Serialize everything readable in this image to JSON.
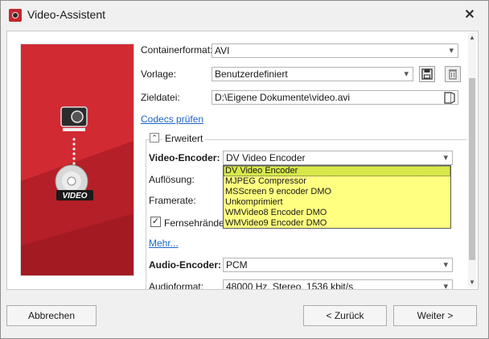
{
  "window": {
    "title": "Video-Assistent",
    "close_symbol": "✕"
  },
  "form": {
    "containerformat_label": "Containerformat:",
    "containerformat_value": "AVI",
    "vorlage_label": "Vorlage:",
    "vorlage_value": "Benutzerdefiniert",
    "zieldatei_label": "Zieldatei:",
    "zieldatei_value": "D:\\Eigene Dokumente\\video.avi",
    "codecs_link": "Codecs prüfen"
  },
  "advanced": {
    "expander_symbol": "⌃",
    "title": "Erweitert",
    "video_encoder_label": "Video-Encoder:",
    "video_encoder_value": "DV Video Encoder",
    "aufloesung_label": "Auflösung:",
    "framerate_label": "Framerate:",
    "fernseh_label": "Fernsehränder",
    "fernseh_checked": true,
    "mehr_link": "Mehr...",
    "audio_encoder_label": "Audio-Encoder:",
    "audio_encoder_value": "PCM",
    "audioformat_label": "Audioformat:",
    "audioformat_value": "48000 Hz, Stereo, 1536 kbit/s"
  },
  "dropdown": {
    "options": [
      "DV Video Encoder",
      "MJPEG Compressor",
      "MSScreen 9 encoder DMO",
      "Unkomprimiert",
      "WMVideo8 Encoder DMO",
      "WMVideo9 Encoder DMO"
    ],
    "selected_index": 0
  },
  "art": {
    "disc_label": "VIDEO"
  },
  "footer": {
    "cancel": "Abbrechen",
    "back": "< Zurück",
    "next": "Weiter >"
  },
  "colors": {
    "art_red": "#c8242c",
    "dropdown_yellow": "#ffff80",
    "link_blue": "#1c64c9"
  }
}
